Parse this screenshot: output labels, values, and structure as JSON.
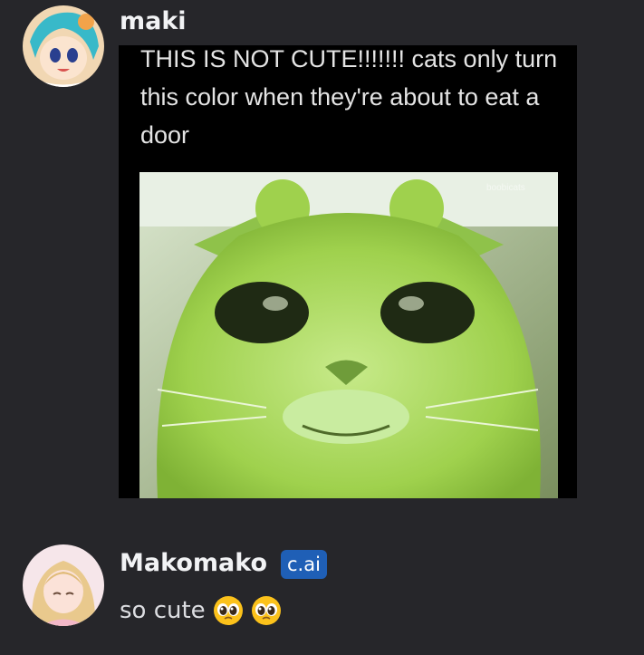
{
  "messages": [
    {
      "author": "maki",
      "image": {
        "caption": "THIS IS NOT CUTE!!!!!!! cats only turn this color when they're about to eat a door",
        "watermark": "boobicats"
      }
    },
    {
      "author": "Makomako",
      "tag": "c.ai",
      "text": "so cute",
      "emojis": [
        "pleading-face-emoji",
        "pleading-face-emoji"
      ]
    }
  ]
}
